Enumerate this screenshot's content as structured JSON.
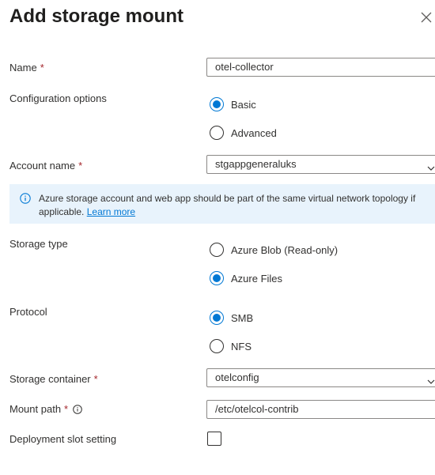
{
  "header": {
    "title": "Add storage mount",
    "close_icon": "close-icon"
  },
  "fields": {
    "name": {
      "label": "Name",
      "required_mark": "*",
      "value": "otel-collector"
    },
    "configuration_options": {
      "label": "Configuration options",
      "options": [
        {
          "label": "Basic",
          "selected": true
        },
        {
          "label": "Advanced",
          "selected": false
        }
      ]
    },
    "account_name": {
      "label": "Account name",
      "required_mark": "*",
      "value": "stgappgeneraluks"
    },
    "storage_type": {
      "label": "Storage type",
      "options": [
        {
          "label": "Azure Blob (Read-only)",
          "selected": false
        },
        {
          "label": "Azure Files",
          "selected": true
        }
      ]
    },
    "protocol": {
      "label": "Protocol",
      "options": [
        {
          "label": "SMB",
          "selected": true
        },
        {
          "label": "NFS",
          "selected": false
        }
      ]
    },
    "storage_container": {
      "label": "Storage container",
      "required_mark": "*",
      "value": "otelconfig"
    },
    "mount_path": {
      "label": "Mount path",
      "required_mark": "*",
      "value": "/etc/otelcol-contrib",
      "info_icon": "info-icon"
    },
    "deployment_slot_setting": {
      "label": "Deployment slot setting",
      "checked": false
    }
  },
  "info_banner": {
    "text": "Azure storage account and web app should be part of the same virtual network topology if applicable.",
    "link": "Learn more",
    "icon": "info-icon"
  },
  "colors": {
    "accent": "#0078d4",
    "required": "#a4262c",
    "banner_bg": "#e8f3fc",
    "text": "#323130"
  }
}
